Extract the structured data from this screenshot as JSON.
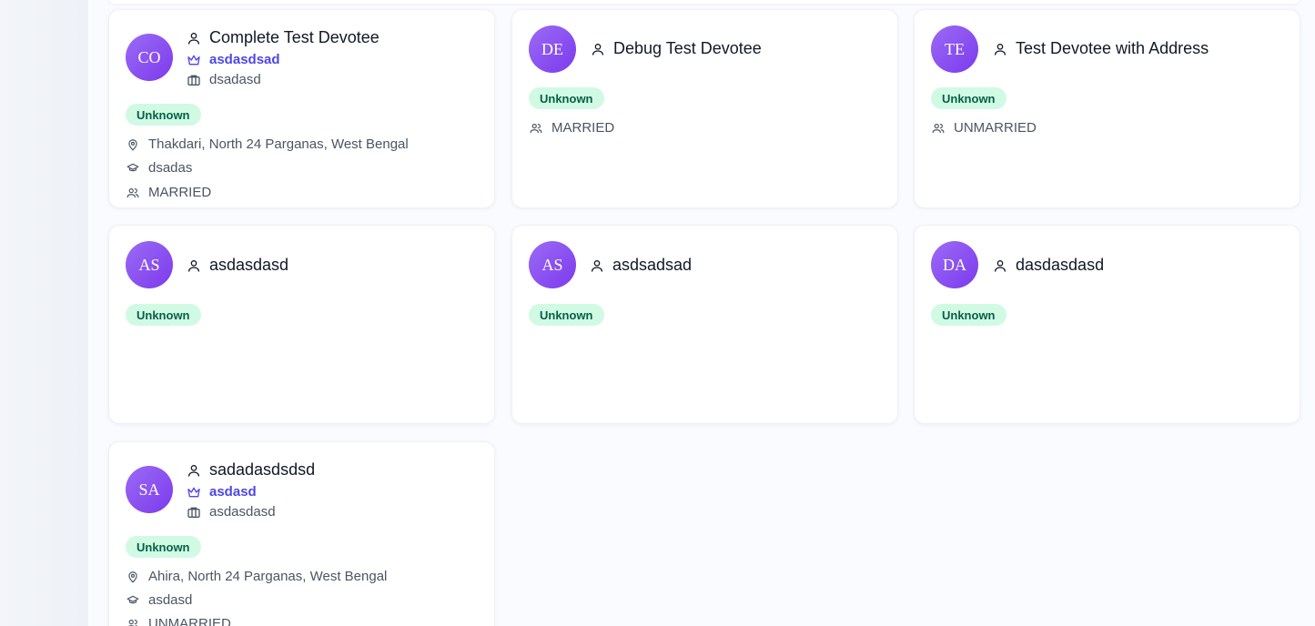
{
  "devotees": [
    {
      "initials": "CO",
      "name": "Complete Test Devotee",
      "leader": "asdasdsad",
      "organization": "dsadasd",
      "status": "Unknown",
      "location": "Thakdari, North 24 Parganas, West Bengal",
      "education": "dsadas",
      "marital": "MARRIED"
    },
    {
      "initials": "DE",
      "name": "Debug Test Devotee",
      "status": "Unknown",
      "marital": "MARRIED"
    },
    {
      "initials": "TE",
      "name": "Test Devotee with Address",
      "status": "Unknown",
      "marital": "UNMARRIED"
    },
    {
      "initials": "AS",
      "name": "asdasdasd",
      "status": "Unknown"
    },
    {
      "initials": "AS",
      "name": "asdsadsad",
      "status": "Unknown"
    },
    {
      "initials": "DA",
      "name": "dasdasdasd",
      "status": "Unknown"
    },
    {
      "initials": "SA",
      "name": "sadadasdsdsd",
      "leader": "asdasd",
      "organization": "asdasdasd",
      "status": "Unknown",
      "location": "Ahira, North 24 Parganas, West Bengal",
      "education": "asdasd",
      "marital": "UNMARRIED"
    }
  ],
  "colors": {
    "avatar_gradient_start": "#9b6bf5",
    "avatar_gradient_end": "#7c3aed",
    "leader_text": "#4f46e5",
    "badge_bg": "#d1fae5",
    "badge_text": "#065f46"
  },
  "icons": {
    "name": "user-icon",
    "leader": "crown-icon",
    "organization": "briefcase-icon",
    "location": "map-pin-icon",
    "education": "graduation-cap-icon",
    "marital": "users-icon"
  }
}
